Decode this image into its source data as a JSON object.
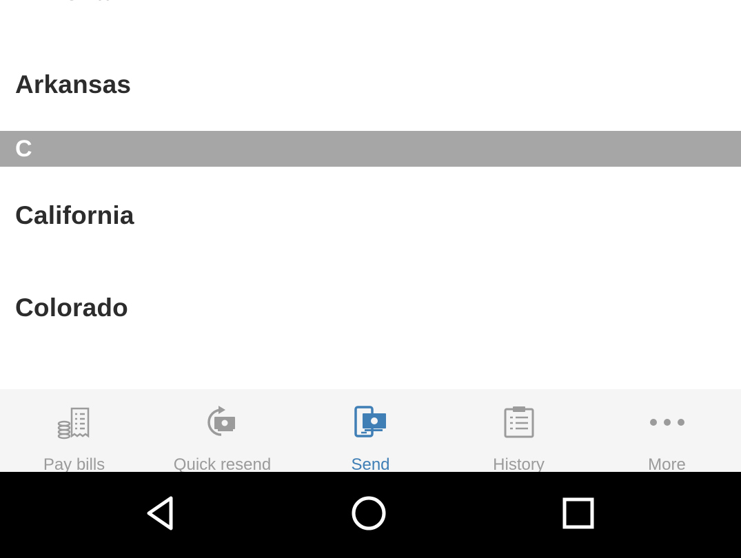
{
  "list": {
    "partial_item": "Arizona",
    "items_before": [
      {
        "label": "Arkansas"
      }
    ],
    "section": {
      "letter": "C"
    },
    "items_after": [
      {
        "label": "California"
      },
      {
        "label": "Colorado"
      }
    ]
  },
  "tabbar": {
    "active_color": "#3f7fb6",
    "inactive_color": "#9b9b9b",
    "tabs": [
      {
        "label": "Pay bills",
        "icon": "pay-bills-icon",
        "active": false
      },
      {
        "label": "Quick resend",
        "icon": "quick-resend-icon",
        "active": false
      },
      {
        "label": "Send",
        "icon": "send-icon",
        "active": true
      },
      {
        "label": "History",
        "icon": "history-icon",
        "active": false
      },
      {
        "label": "More",
        "icon": "more-icon",
        "active": false
      }
    ]
  },
  "navbar": {
    "buttons": [
      {
        "icon": "back-icon"
      },
      {
        "icon": "home-icon"
      },
      {
        "icon": "recents-icon"
      }
    ]
  }
}
